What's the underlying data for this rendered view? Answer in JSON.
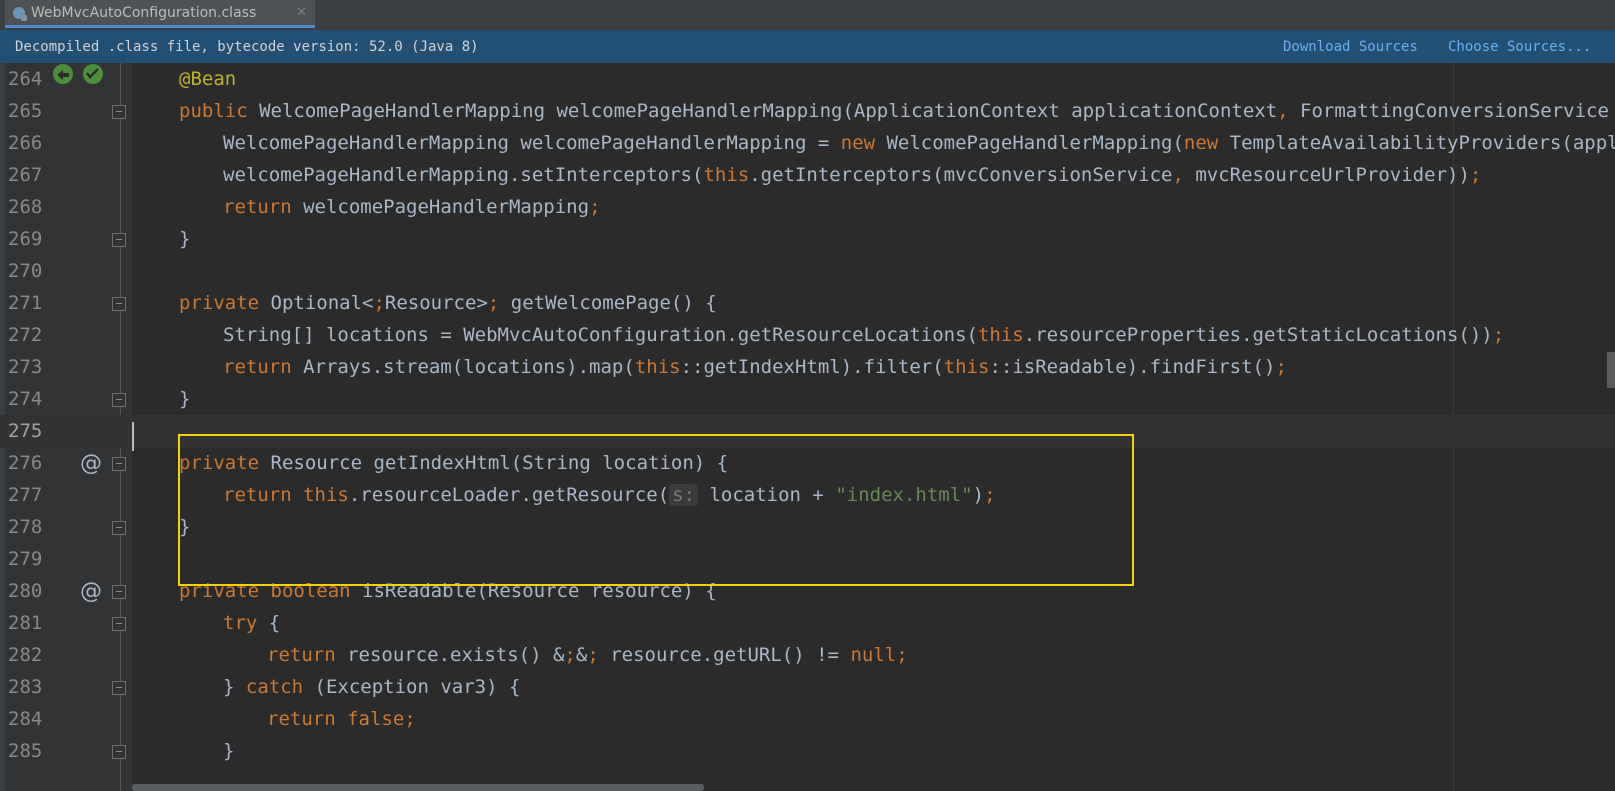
{
  "tab": {
    "title": "WebMvcAutoConfiguration.class",
    "close": "✕",
    "icon": "class-file-icon"
  },
  "banner": {
    "message": "Decompiled .class file, bytecode version: 52.0 (Java 8)",
    "download_sources": "Download Sources",
    "choose_sources": "Choose Sources..."
  },
  "lines": [
    {
      "n": "264",
      "text": "@Bean"
    },
    {
      "n": "265",
      "text": "public WelcomePageHandlerMapping welcomePageHandlerMapping(ApplicationContext applicationContext, FormattingConversionService m"
    },
    {
      "n": "266",
      "text": "WelcomePageHandlerMapping welcomePageHandlerMapping = new WelcomePageHandlerMapping(new TemplateAvailabilityProviders(appli"
    },
    {
      "n": "267",
      "text": "welcomePageHandlerMapping.setInterceptors(this.getInterceptors(mvcConversionService, mvcResourceUrlProvider));"
    },
    {
      "n": "268",
      "text": "return welcomePageHandlerMapping;"
    },
    {
      "n": "269",
      "text": "}"
    },
    {
      "n": "270",
      "text": ""
    },
    {
      "n": "271",
      "text": "private Optional<Resource> getWelcomePage() {"
    },
    {
      "n": "272",
      "text": "String[] locations = WebMvcAutoConfiguration.getResourceLocations(this.resourceProperties.getStaticLocations());"
    },
    {
      "n": "273",
      "text": "return Arrays.stream(locations).map(this::getIndexHtml).filter(this::isReadable).findFirst();"
    },
    {
      "n": "274",
      "text": "}"
    },
    {
      "n": "275",
      "text": ""
    },
    {
      "n": "276",
      "text": "private Resource getIndexHtml(String location) {"
    },
    {
      "n": "277",
      "text": "return this.resourceLoader.getResource(s: location + \"index.html\");"
    },
    {
      "n": "278",
      "text": "}"
    },
    {
      "n": "279",
      "text": ""
    },
    {
      "n": "280",
      "text": "private boolean isReadable(Resource resource) {"
    },
    {
      "n": "281",
      "text": "try {"
    },
    {
      "n": "282",
      "text": "return resource.exists() && resource.getURL() != null;"
    },
    {
      "n": "283",
      "text": "} catch (Exception var3) {"
    },
    {
      "n": "284",
      "text": "return false;"
    },
    {
      "n": "285",
      "text": "}"
    }
  ],
  "gutter_marks": {
    "override_symbol": "@"
  },
  "colors": {
    "keyword": "#cc7832",
    "annotation": "#bbb529",
    "string": "#6a8759",
    "text": "#a9b7c6",
    "highlight_box": "#f3d30b",
    "banner_bg": "#224f72",
    "link": "#6ab0f3"
  }
}
